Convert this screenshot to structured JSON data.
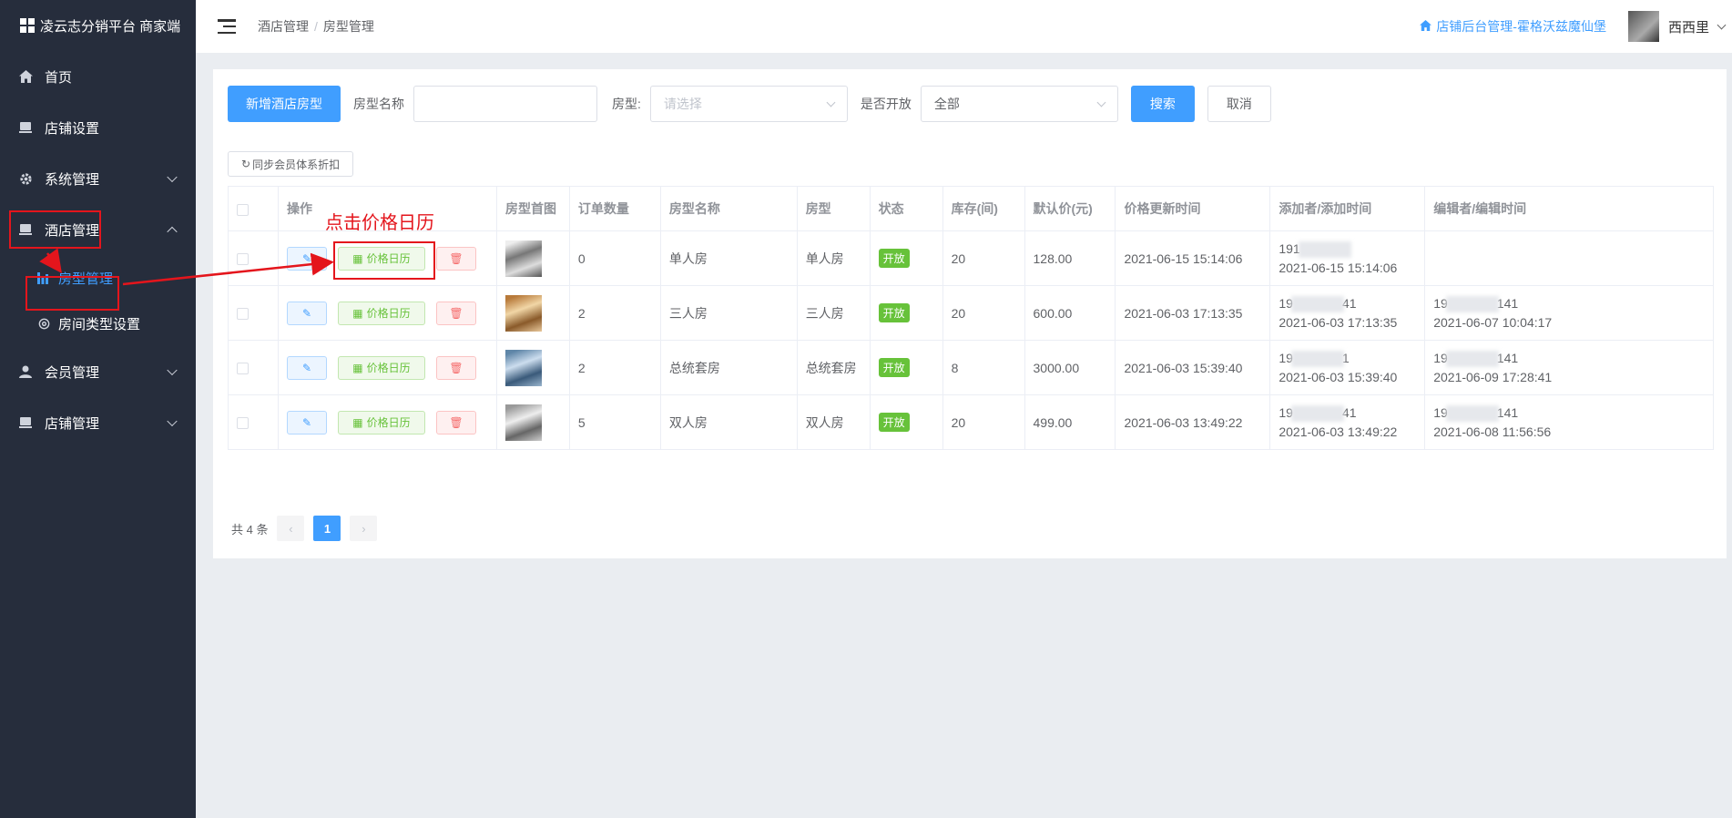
{
  "app": {
    "title": "凌云志分销平台 商家端"
  },
  "sidebar": {
    "items": [
      {
        "label": "首页",
        "icon": "home-icon"
      },
      {
        "label": "店铺设置",
        "icon": "shop-icon"
      },
      {
        "label": "系统管理",
        "icon": "gear-icon"
      },
      {
        "label": "酒店管理",
        "icon": "hotel-icon",
        "expanded": true,
        "children": [
          {
            "label": "房型管理",
            "icon": "chart-icon",
            "active": true
          },
          {
            "label": "房间类型设置",
            "icon": "gear-icon"
          }
        ]
      },
      {
        "label": "会员管理",
        "icon": "user-icon"
      },
      {
        "label": "店铺管理",
        "icon": "shop-icon"
      }
    ]
  },
  "header": {
    "breadcrumb": [
      "酒店管理",
      "房型管理"
    ],
    "shop_link": "店铺后台管理-霍格沃兹魔仙堡",
    "username": "西西里"
  },
  "toolbar": {
    "add_button": "新增酒店房型",
    "room_name_label": "房型名称",
    "room_name_value": "",
    "room_type_label": "房型:",
    "room_type_placeholder": "请选择",
    "open_label": "是否开放",
    "open_value": "全部",
    "search_button": "搜索",
    "cancel_button": "取消",
    "sync_button": "同步会员体系折扣"
  },
  "table": {
    "headers": [
      "操作",
      "房型首图",
      "订单数量",
      "房型名称",
      "房型",
      "状态",
      "库存(间)",
      "默认价(元)",
      "价格更新时间",
      "添加者/添加时间",
      "编辑者/编辑时间"
    ],
    "calendar_label": "价格日历",
    "rows": [
      {
        "orders": "0",
        "name": "单人房",
        "type": "单人房",
        "status": "开放",
        "stock": "20",
        "price": "128.00",
        "updated": "2021-06-15 15:14:06",
        "adder_a": "191",
        "adder_b": "",
        "added": "2021-06-15 15:14:06",
        "editor_a": "",
        "editor_b": "",
        "edited": ""
      },
      {
        "orders": "2",
        "name": "三人房",
        "type": "三人房",
        "status": "开放",
        "stock": "20",
        "price": "600.00",
        "updated": "2021-06-03 17:13:35",
        "adder_a": "19",
        "adder_b": "41",
        "added": "2021-06-03 17:13:35",
        "editor_a": "19",
        "editor_b": "141",
        "edited": "2021-06-07 10:04:17"
      },
      {
        "orders": "2",
        "name": "总统套房",
        "type": "总统套房",
        "status": "开放",
        "stock": "8",
        "price": "3000.00",
        "updated": "2021-06-03 15:39:40",
        "adder_a": "19",
        "adder_b": "1",
        "added": "2021-06-03 15:39:40",
        "editor_a": "19",
        "editor_b": "141",
        "edited": "2021-06-09 17:28:41"
      },
      {
        "orders": "5",
        "name": "双人房",
        "type": "双人房",
        "status": "开放",
        "stock": "20",
        "price": "499.00",
        "updated": "2021-06-03 13:49:22",
        "adder_a": "19",
        "adder_b": "41",
        "added": "2021-06-03 13:49:22",
        "editor_a": "19",
        "editor_b": "141",
        "edited": "2021-06-08 11:56:56"
      }
    ]
  },
  "pager": {
    "total": "共 4 条",
    "current": "1"
  },
  "annotation": {
    "text": "点击价格日历"
  },
  "colors": {
    "primary": "#409eff",
    "success": "#67c23a",
    "danger": "#f56c6c",
    "sidebar": "#262d3c",
    "annotation": "#e4151c"
  }
}
